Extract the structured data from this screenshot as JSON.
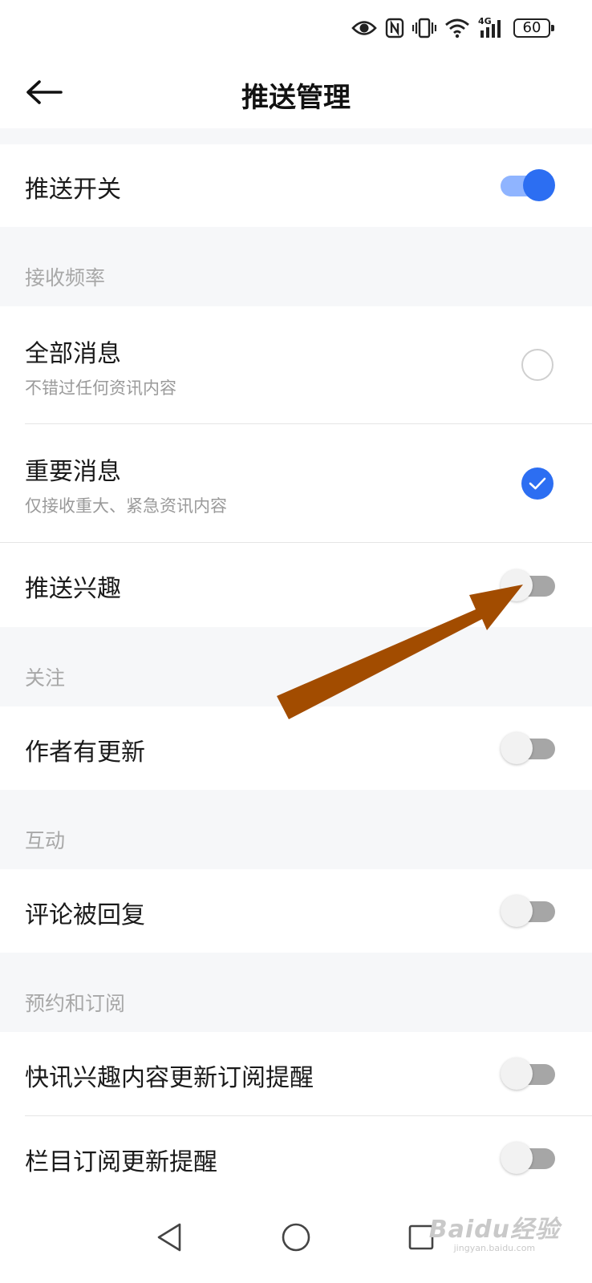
{
  "status_bar": {
    "battery": "60",
    "network": "4G"
  },
  "header": {
    "title": "推送管理"
  },
  "push_switch": {
    "label": "推送开关",
    "on": true
  },
  "sections": {
    "frequency": "接收频率",
    "follow": "关注",
    "interaction": "互动",
    "subscription": "预约和订阅"
  },
  "frequency_options": [
    {
      "label": "全部消息",
      "desc": "不错过任何资讯内容",
      "selected": false
    },
    {
      "label": "重要消息",
      "desc": "仅接收重大、紧急资讯内容",
      "selected": true
    }
  ],
  "toggles": {
    "interest": {
      "label": "推送兴趣",
      "on": false
    },
    "author_update": {
      "label": "作者有更新",
      "on": false
    },
    "comment_reply": {
      "label": "评论被回复",
      "on": false
    },
    "flash_interest": {
      "label": "快讯兴趣内容更新订阅提醒",
      "on": false
    },
    "column_subscription": {
      "label": "栏目订阅更新提醒",
      "on": false
    }
  },
  "watermark": {
    "main": "Baidu经验",
    "sub": "jingyan.baidu.com"
  },
  "colors": {
    "accent": "#2c6ef2",
    "annotation_arrow": "#a24c00"
  }
}
